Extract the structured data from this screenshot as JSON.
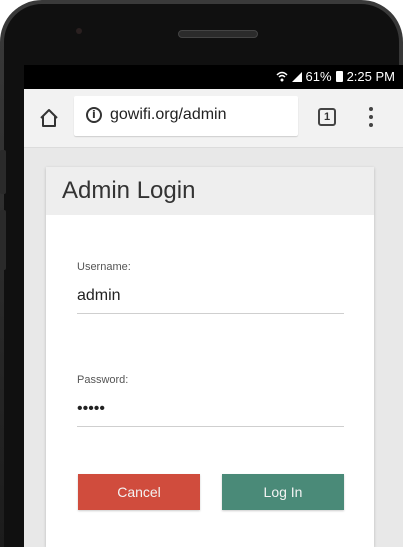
{
  "status_bar": {
    "battery": "61%",
    "time": "2:25 PM"
  },
  "browser": {
    "url": "gowifi.org/admin",
    "tab_count": "1"
  },
  "login": {
    "title": "Admin Login",
    "username_label": "Username:",
    "username_value": "admin",
    "password_label": "Password:",
    "password_value": "•••••",
    "cancel_label": "Cancel",
    "login_label": "Log In"
  },
  "colors": {
    "cancel": "#d04c3d",
    "login": "#4a8a78"
  },
  "icons": [
    "wifi-icon",
    "signal-icon",
    "battery-icon",
    "home-icon",
    "info-icon",
    "tabs-icon",
    "menu-icon"
  ]
}
